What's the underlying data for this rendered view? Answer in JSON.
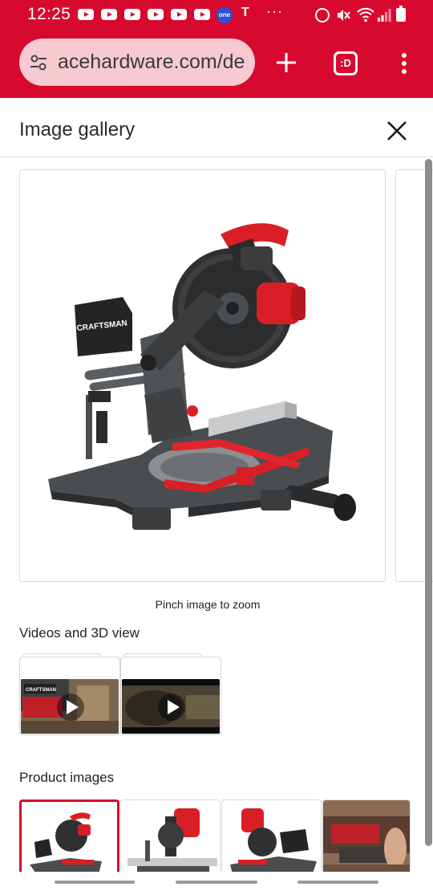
{
  "status_bar": {
    "time": "12:25",
    "carrier_badge": "one",
    "carrier_mark": "T",
    "more": "···"
  },
  "browser": {
    "url": "acehardware.com/de",
    "tab_label": ":D",
    "theme_color": "#d8092e"
  },
  "gallery": {
    "title": "Image gallery",
    "main_image": {
      "brand_text": "CRAFTSMAN",
      "blade_text": "CRAFTSMAN"
    },
    "zoom_hint": "Pinch image to zoom"
  },
  "videos": {
    "section_title": "Videos and 3D view",
    "thumbnail_brand": "CRAFTSMAN",
    "items": [
      {
        "label": "video-1"
      },
      {
        "label": "video-2"
      }
    ]
  },
  "product_images": {
    "section_title": "Product images",
    "selected_index": 0
  },
  "icons": {
    "close": "close-icon",
    "new_tab": "plus-icon",
    "menu": "more-vert-icon",
    "site_settings": "tune-icon",
    "play": "play-icon"
  }
}
